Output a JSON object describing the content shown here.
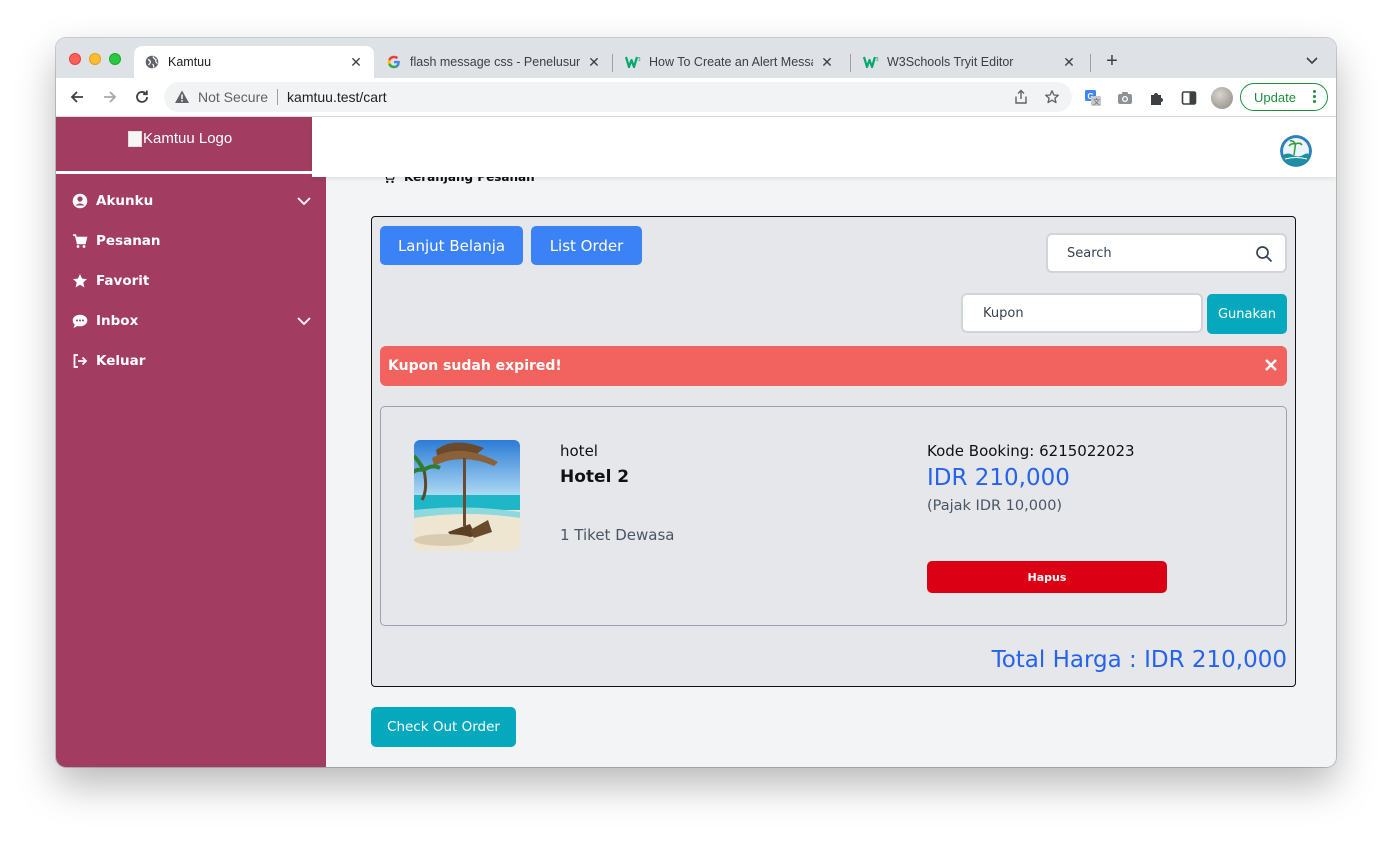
{
  "browser": {
    "tabs": [
      {
        "title": "Kamtuu",
        "icon": "globe-icon"
      },
      {
        "title": "flash message css - Penelusuran",
        "icon": "google-icon"
      },
      {
        "title": "How To Create an Alert Message",
        "icon": "w3schools-icon"
      },
      {
        "title": "W3Schools Tryit Editor",
        "icon": "w3schools-icon"
      }
    ],
    "address": {
      "security_label": "Not Secure",
      "url": "kamtuu.test/cart"
    },
    "update_label": "Update"
  },
  "sidebar": {
    "logo_alt": "Kamtuu Logo",
    "items": [
      {
        "label": "Akunku",
        "icon": "user-circle-icon",
        "has_submenu": true
      },
      {
        "label": "Pesanan",
        "icon": "cart-icon",
        "has_submenu": false
      },
      {
        "label": "Favorit",
        "icon": "star-icon",
        "has_submenu": false
      },
      {
        "label": "Inbox",
        "icon": "chat-icon",
        "has_submenu": true
      },
      {
        "label": "Keluar",
        "icon": "logout-icon",
        "has_submenu": false
      }
    ]
  },
  "header": {
    "breadcrumb": "Keranjang Pesanan"
  },
  "cart": {
    "continue_label": "Lanjut Belanja",
    "list_order_label": "List Order",
    "search_placeholder": "Search",
    "coupon_placeholder": "Kupon",
    "coupon_button": "Gunakan",
    "alert_message": "Kupon sudah expired!",
    "item": {
      "category": "hotel",
      "name": "Hotel 2",
      "quantity": "1 Tiket Dewasa",
      "booking_code": "Kode Booking: 6215022023",
      "price": "IDR 210,000",
      "tax": "(Pajak IDR 10,000)",
      "delete_label": "Hapus"
    },
    "total": "Total Harga : IDR 210,000",
    "checkout_label": "Check Out Order"
  },
  "colors": {
    "sidebar": "#a23d61",
    "primary_blue": "#3b82f6",
    "teal": "#06a8bd",
    "alert_red": "#f2625f",
    "delete_red": "#dc0014",
    "price_blue": "#2563eb"
  }
}
